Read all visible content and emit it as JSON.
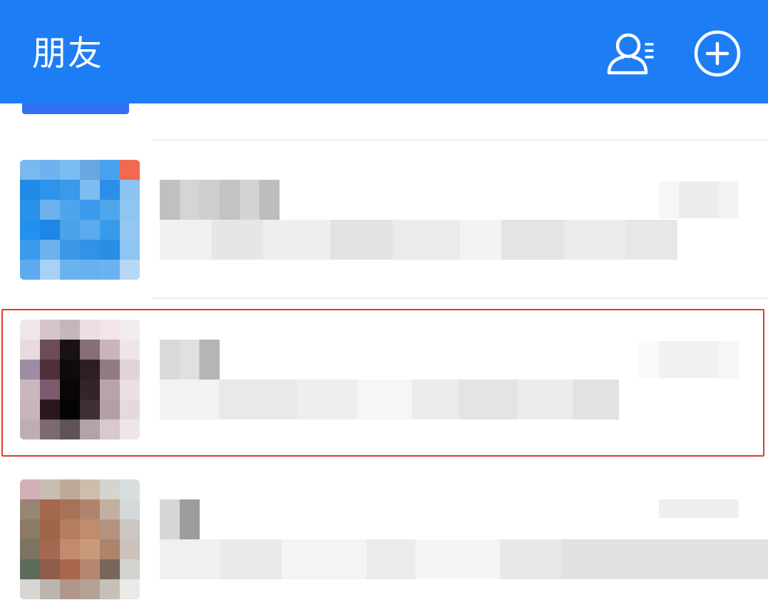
{
  "header": {
    "title": "朋友",
    "contacts_icon": "contacts-icon",
    "add_icon": "plus-circle-icon"
  },
  "colors": {
    "header_bg": "#1d7df5",
    "highlight_border": "#e23b2e"
  }
}
